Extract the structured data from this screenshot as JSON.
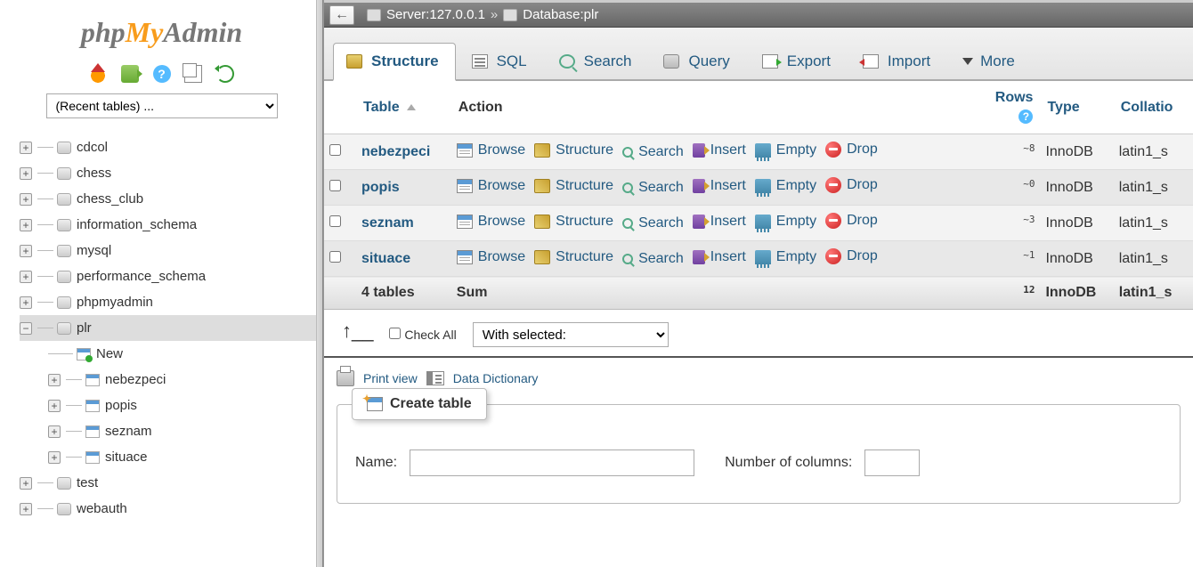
{
  "logo": {
    "php": "php",
    "my": "My",
    "admin": "Admin"
  },
  "recent_placeholder": "(Recent tables) ...",
  "breadcrumb": {
    "server_label": "Server: ",
    "server_value": "127.0.0.1",
    "separator": " » ",
    "db_label": "Database: ",
    "db_value": "plr"
  },
  "tabs": {
    "structure": "Structure",
    "sql": "SQL",
    "search": "Search",
    "query": "Query",
    "export": "Export",
    "import": "Import",
    "more": "More"
  },
  "headers": {
    "table": "Table",
    "action": "Action",
    "rows": "Rows",
    "type": "Type",
    "collation": "Collatio"
  },
  "actions": {
    "browse": "Browse",
    "structure": "Structure",
    "search": "Search",
    "insert": "Insert",
    "empty": "Empty",
    "drop": "Drop"
  },
  "tables": [
    {
      "name": "nebezpeci",
      "rows_prefix": "~",
      "rows": "8",
      "type": "InnoDB",
      "collation": "latin1_s"
    },
    {
      "name": "popis",
      "rows_prefix": "~",
      "rows": "0",
      "type": "InnoDB",
      "collation": "latin1_s"
    },
    {
      "name": "seznam",
      "rows_prefix": "~",
      "rows": "3",
      "type": "InnoDB",
      "collation": "latin1_s"
    },
    {
      "name": "situace",
      "rows_prefix": "~",
      "rows": "1",
      "type": "InnoDB",
      "collation": "latin1_s"
    }
  ],
  "sum": {
    "label": "4 tables",
    "sum": "Sum",
    "rows": "12",
    "type": "InnoDB",
    "collation": "latin1_s"
  },
  "check_all": "Check All",
  "with_selected": "With selected:",
  "print_view": "Print view",
  "data_dictionary": "Data Dictionary",
  "create_table_legend": "Create table",
  "form": {
    "name_label": "Name:",
    "cols_label": "Number of columns:"
  },
  "tree": {
    "dbs": [
      "cdcol",
      "chess",
      "chess_club",
      "information_schema",
      "mysql",
      "performance_schema",
      "phpmyadmin"
    ],
    "selected_db": "plr",
    "new_label": "New",
    "seltables": [
      "nebezpeci",
      "popis",
      "seznam",
      "situace"
    ],
    "dbs_after": [
      "test",
      "webauth"
    ]
  }
}
